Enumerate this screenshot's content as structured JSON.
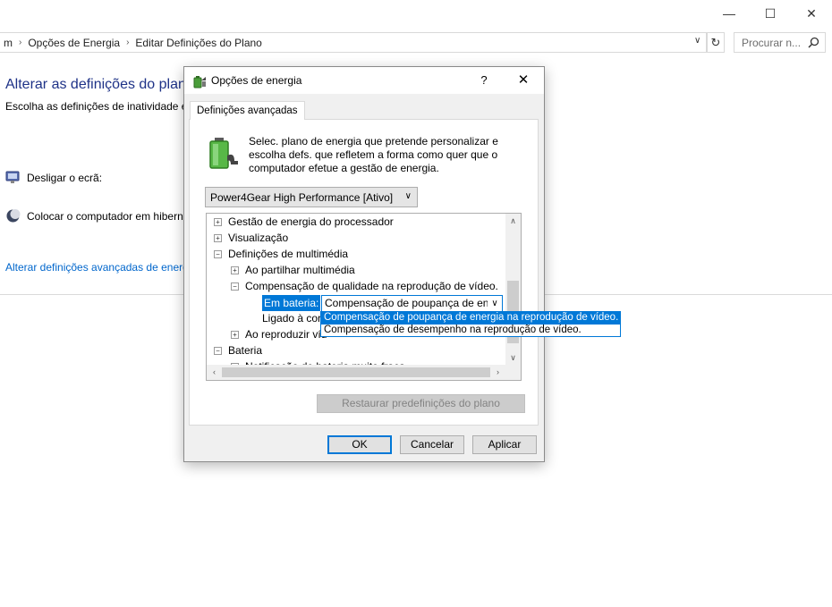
{
  "window": {
    "minimize": "—",
    "maximize": "☐",
    "close": "✕"
  },
  "address": {
    "crumbs": [
      "m",
      "Opções de Energia",
      "Editar Definições do Plano"
    ],
    "search_placeholder": "Procurar n..."
  },
  "background": {
    "title": "Alterar as definições do plano",
    "subtitle": "Escolha as definições de inatividade e",
    "display_off_label": "Desligar o ecrã:",
    "sleep_label": "Colocar o computador em hibern",
    "advanced_link": "Alterar definições avançadas de energ"
  },
  "dialog": {
    "title": "Opções de energia",
    "help": "?",
    "close": "✕",
    "tab": "Definições avançadas",
    "intro": "Selec. plano de energia que pretende personalizar e escolha defs. que refletem a forma como quer que o computador efetue a gestão de energia.",
    "plan_selected": "Power4Gear High Performance [Ativo]",
    "tree": [
      {
        "label": "Gestão de energia do processador",
        "toggle": "+"
      },
      {
        "label": "Visualização",
        "toggle": "+"
      },
      {
        "label": "Definições de multimédia",
        "toggle": "−"
      },
      {
        "label": "Ao partilhar multimédia",
        "toggle": "+"
      },
      {
        "label": "Compensação de qualidade na reprodução de vídeo.",
        "toggle": "−"
      },
      {
        "label": "Em bateria:",
        "toggle": ""
      },
      {
        "label": "Ligado à cor",
        "toggle": ""
      },
      {
        "label": "Ao reproduzir víd",
        "toggle": "+"
      },
      {
        "label": "Bateria",
        "toggle": "−"
      },
      {
        "label": "Notificação de bateria muito fraca",
        "toggle": "+"
      }
    ],
    "battery_value": "Compensação de poupança de ene",
    "dropdown_options": [
      "Compensação de poupança de energia na reprodução de vídeo.",
      "Compensação de desempenho na reprodução de vídeo."
    ],
    "restore_button": "Restaurar predefinições do plano",
    "ok": "OK",
    "cancel": "Cancelar",
    "apply": "Aplicar"
  }
}
